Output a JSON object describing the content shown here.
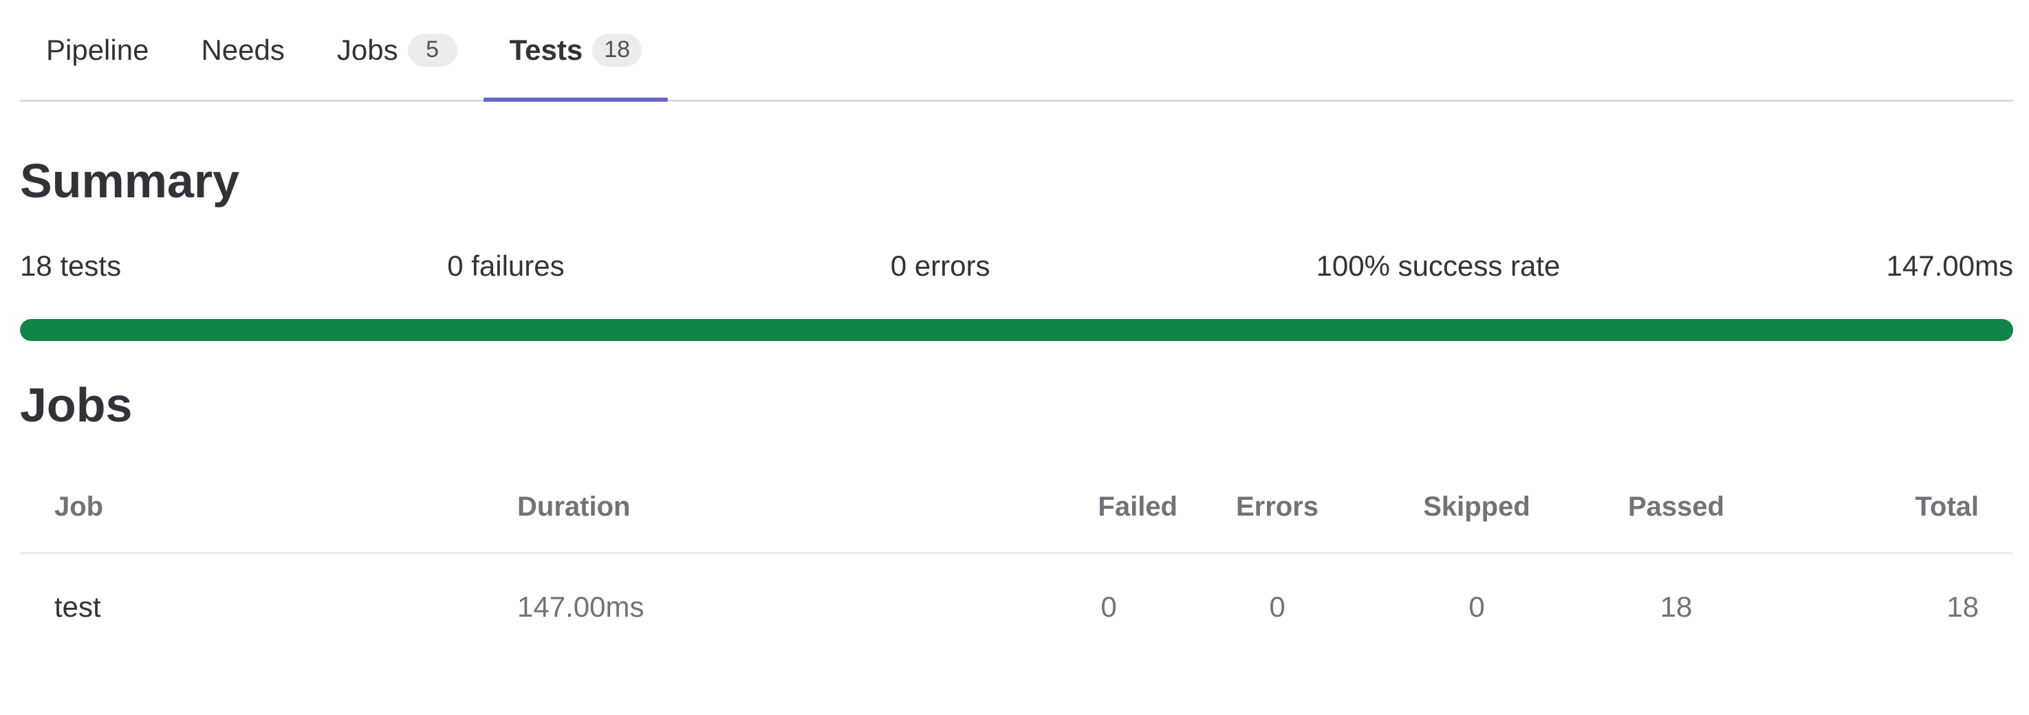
{
  "tabs": [
    {
      "label": "Pipeline",
      "count": null,
      "active": false
    },
    {
      "label": "Needs",
      "count": null,
      "active": false
    },
    {
      "label": "Jobs",
      "count": "5",
      "active": false
    },
    {
      "label": "Tests",
      "count": "18",
      "active": true
    }
  ],
  "summary": {
    "title": "Summary",
    "tests": "18 tests",
    "failures": "0 failures",
    "errors": "0 errors",
    "success_rate": "100% success rate",
    "duration": "147.00ms",
    "progress_fraction": 1.0,
    "progress_color": "#108548"
  },
  "jobs": {
    "title": "Jobs",
    "headers": {
      "job": "Job",
      "duration": "Duration",
      "failed": "Failed",
      "errors": "Errors",
      "skipped": "Skipped",
      "passed": "Passed",
      "total": "Total"
    },
    "rows": [
      {
        "job": "test",
        "duration": "147.00ms",
        "failed": "0",
        "errors": "0",
        "skipped": "0",
        "passed": "18",
        "total": "18"
      }
    ]
  },
  "colors": {
    "active_tab_indicator": "#6666c4",
    "success": "#108548"
  }
}
